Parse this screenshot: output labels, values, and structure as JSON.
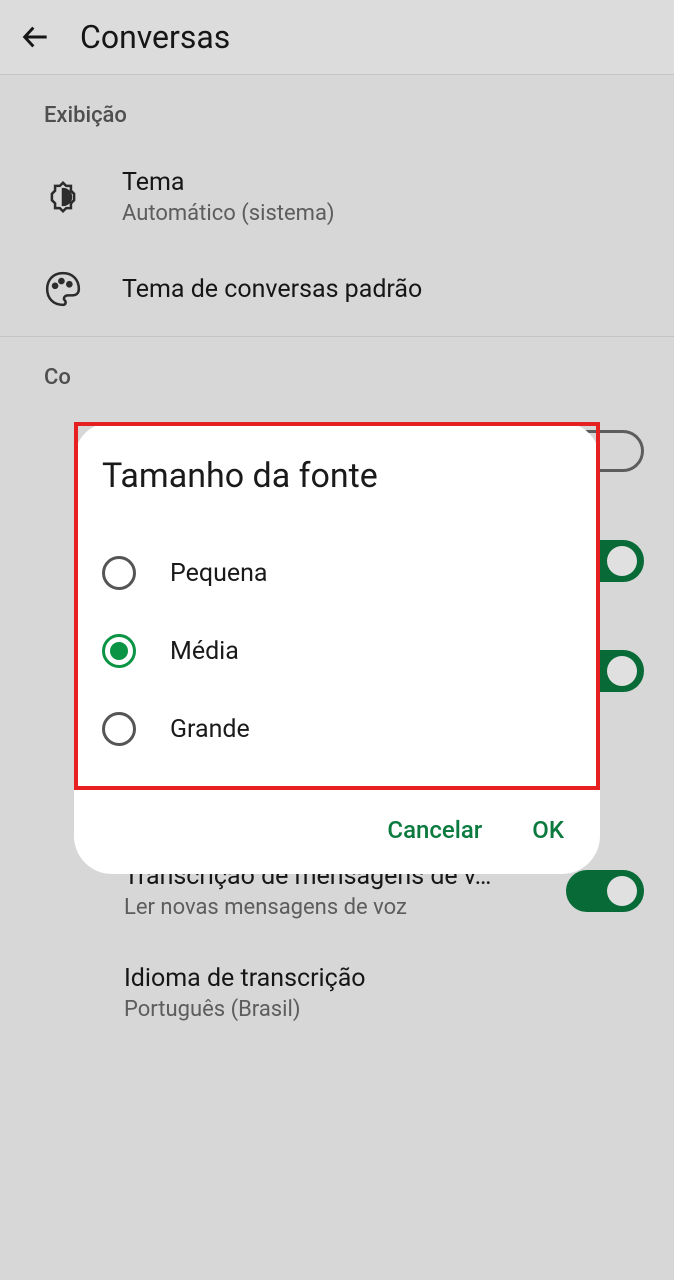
{
  "header": {
    "title": "Conversas"
  },
  "sections": {
    "display": {
      "label": "Exibição",
      "theme": {
        "title": "Tema",
        "subtitle": "Automático (sistema)"
      },
      "chat_theme": {
        "title": "Tema de conversas padrão"
      }
    },
    "chat_settings": {
      "label": "Configurações de conversa",
      "label_truncated": "Co",
      "font_size": {
        "title": "Tamanho da fonte",
        "subtitle": "Média"
      },
      "voice_transcription": {
        "title": "Transcrição de mensagens de v…",
        "subtitle": "Ler novas mensagens de voz"
      },
      "transcription_language": {
        "title": "Idioma de transcrição",
        "subtitle": "Português (Brasil)"
      }
    }
  },
  "dialog": {
    "title": "Tamanho da fonte",
    "options": {
      "small": "Pequena",
      "medium": "Média",
      "large": "Grande"
    },
    "selected": "medium",
    "cancel": "Cancelar",
    "ok": "OK"
  },
  "highlight_box": true
}
